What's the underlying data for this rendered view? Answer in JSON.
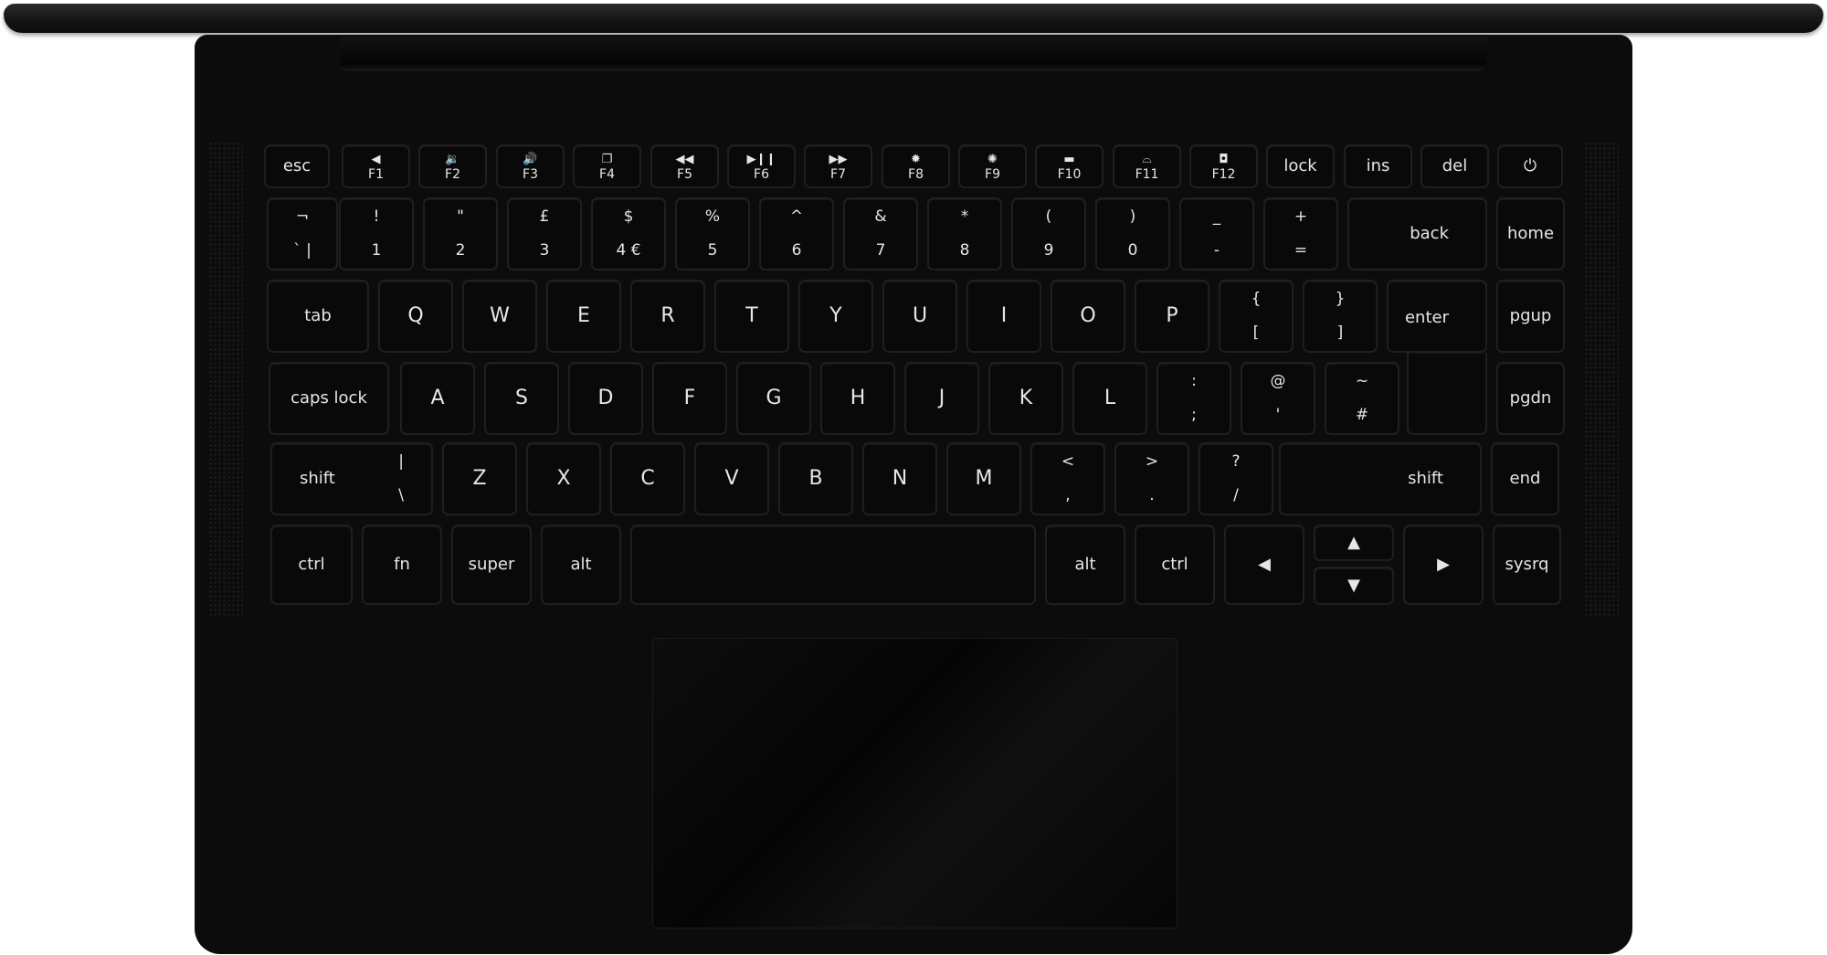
{
  "keyboard": {
    "function_row": [
      {
        "id": "esc",
        "label": "esc"
      },
      {
        "id": "f1",
        "label": "F1",
        "icon": "volume-mute-icon",
        "glyph": "◀"
      },
      {
        "id": "f2",
        "label": "F2",
        "icon": "volume-down-icon",
        "glyph": "🔉"
      },
      {
        "id": "f3",
        "label": "F3",
        "icon": "volume-up-icon",
        "glyph": "🔊"
      },
      {
        "id": "f4",
        "label": "F4",
        "icon": "window-switch-icon",
        "glyph": "❐"
      },
      {
        "id": "f5",
        "label": "F5",
        "icon": "rewind-icon",
        "glyph": "◀◀"
      },
      {
        "id": "f6",
        "label": "F6",
        "icon": "play-pause-icon",
        "glyph": "▶❙❙"
      },
      {
        "id": "f7",
        "label": "F7",
        "icon": "fast-forward-icon",
        "glyph": "▶▶"
      },
      {
        "id": "f8",
        "label": "F8",
        "icon": "brightness-down-icon",
        "glyph": "✹"
      },
      {
        "id": "f9",
        "label": "F9",
        "icon": "brightness-up-icon",
        "glyph": "✺"
      },
      {
        "id": "f10",
        "label": "F10",
        "icon": "display-icon",
        "glyph": "▬"
      },
      {
        "id": "f11",
        "label": "F11",
        "icon": "keyboard-backlight-icon",
        "glyph": "⌓"
      },
      {
        "id": "f12",
        "label": "F12",
        "icon": "camera-icon",
        "glyph": "◘"
      },
      {
        "id": "lock",
        "label": "lock"
      },
      {
        "id": "ins",
        "label": "ins"
      },
      {
        "id": "del",
        "label": "del"
      },
      {
        "id": "power",
        "label": "⏻",
        "icon": "power-icon"
      }
    ],
    "number_row": [
      {
        "id": "backtick",
        "top": "¬",
        "bot": "`  |"
      },
      {
        "id": "1",
        "top": "!",
        "bot": "1"
      },
      {
        "id": "2",
        "top": "\"",
        "bot": "2"
      },
      {
        "id": "3",
        "top": "£",
        "bot": "3"
      },
      {
        "id": "4",
        "top": "$",
        "bot": "4  €"
      },
      {
        "id": "5",
        "top": "%",
        "bot": "5"
      },
      {
        "id": "6",
        "top": "^",
        "bot": "6"
      },
      {
        "id": "7",
        "top": "&",
        "bot": "7"
      },
      {
        "id": "8",
        "top": "*",
        "bot": "8"
      },
      {
        "id": "9",
        "top": "(",
        "bot": "9"
      },
      {
        "id": "0",
        "top": ")",
        "bot": "0"
      },
      {
        "id": "minus",
        "top": "_",
        "bot": "-"
      },
      {
        "id": "equals",
        "top": "+",
        "bot": "="
      },
      {
        "id": "back",
        "label": "back"
      },
      {
        "id": "home",
        "label": "home"
      }
    ],
    "qwerty_row": [
      {
        "id": "tab",
        "label": "tab"
      },
      {
        "id": "q",
        "label": "Q"
      },
      {
        "id": "w",
        "label": "W"
      },
      {
        "id": "e",
        "label": "E"
      },
      {
        "id": "r",
        "label": "R"
      },
      {
        "id": "t",
        "label": "T"
      },
      {
        "id": "y",
        "label": "Y"
      },
      {
        "id": "u",
        "label": "U"
      },
      {
        "id": "i",
        "label": "I"
      },
      {
        "id": "o",
        "label": "O"
      },
      {
        "id": "p",
        "label": "P"
      },
      {
        "id": "lbracket",
        "top": "{",
        "bot": "["
      },
      {
        "id": "rbracket",
        "top": "}",
        "bot": "]"
      },
      {
        "id": "enter",
        "label": "enter"
      },
      {
        "id": "pgup",
        "label": "pgup"
      }
    ],
    "home_row": [
      {
        "id": "capslock",
        "label": "caps lock"
      },
      {
        "id": "a",
        "label": "A"
      },
      {
        "id": "s",
        "label": "S"
      },
      {
        "id": "d",
        "label": "D"
      },
      {
        "id": "f",
        "label": "F"
      },
      {
        "id": "g",
        "label": "G"
      },
      {
        "id": "h",
        "label": "H"
      },
      {
        "id": "j",
        "label": "J"
      },
      {
        "id": "k",
        "label": "K"
      },
      {
        "id": "l",
        "label": "L"
      },
      {
        "id": "semicolon",
        "top": ":",
        "bot": ";"
      },
      {
        "id": "quote",
        "top": "@",
        "bot": "'"
      },
      {
        "id": "hash",
        "top": "~",
        "bot": "#"
      },
      {
        "id": "pgdn",
        "label": "pgdn"
      }
    ],
    "shift_row": [
      {
        "id": "lshift",
        "label": "shift",
        "top": "|",
        "bot": "\\"
      },
      {
        "id": "z",
        "label": "Z"
      },
      {
        "id": "x",
        "label": "X"
      },
      {
        "id": "c",
        "label": "C"
      },
      {
        "id": "v",
        "label": "V"
      },
      {
        "id": "b",
        "label": "B"
      },
      {
        "id": "n",
        "label": "N"
      },
      {
        "id": "m",
        "label": "M"
      },
      {
        "id": "comma",
        "top": "<",
        "bot": ","
      },
      {
        "id": "period",
        "top": ">",
        "bot": "."
      },
      {
        "id": "slash",
        "top": "?",
        "bot": "/"
      },
      {
        "id": "rshift",
        "label": "shift"
      },
      {
        "id": "end",
        "label": "end"
      }
    ],
    "bottom_row": [
      {
        "id": "lctrl",
        "label": "ctrl"
      },
      {
        "id": "fn",
        "label": "fn"
      },
      {
        "id": "super",
        "label": "super"
      },
      {
        "id": "lalt",
        "label": "alt"
      },
      {
        "id": "space",
        "label": ""
      },
      {
        "id": "ralt",
        "label": "alt"
      },
      {
        "id": "rctrl",
        "label": "ctrl"
      },
      {
        "id": "left",
        "label": "◀",
        "icon": "arrow-left-icon"
      },
      {
        "id": "up",
        "label": "▲",
        "icon": "arrow-up-icon"
      },
      {
        "id": "down",
        "label": "▼",
        "icon": "arrow-down-icon"
      },
      {
        "id": "right",
        "label": "▶",
        "icon": "arrow-right-icon"
      },
      {
        "id": "sysrq",
        "label": "sysrq"
      }
    ]
  }
}
